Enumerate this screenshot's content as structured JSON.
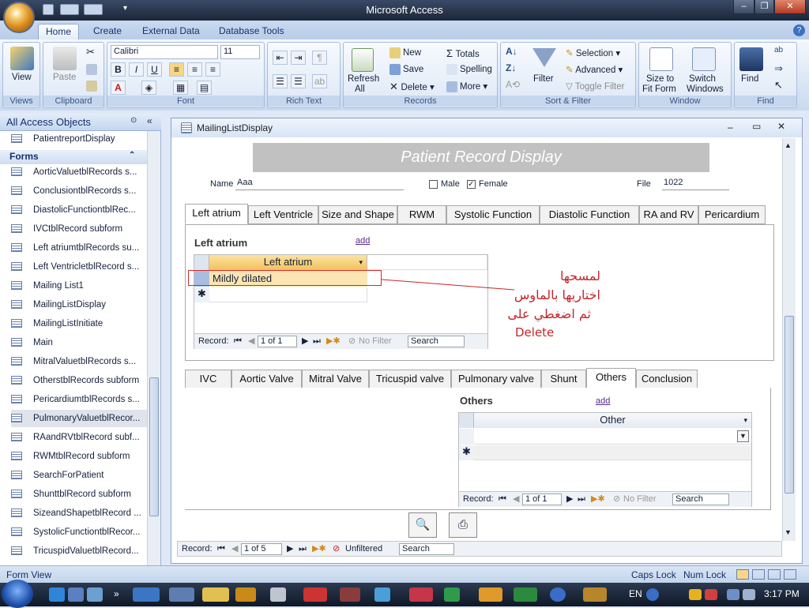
{
  "window": {
    "title": "Microsoft Access"
  },
  "ribbon": {
    "tabs": [
      "Home",
      "Create",
      "External Data",
      "Database Tools"
    ],
    "active_tab": "Home",
    "views": {
      "view": "View",
      "label": "Views"
    },
    "clipboard": {
      "paste": "Paste",
      "label": "Clipboard"
    },
    "font": {
      "family": "Calibri",
      "size": "11",
      "label": "Font"
    },
    "rich_text": {
      "label": "Rich Text"
    },
    "records": {
      "refresh": "Refresh",
      "refresh_all": "All",
      "new": "New",
      "save": "Save",
      "delete": "Delete",
      "totals": "Totals",
      "spelling": "Spelling",
      "more": "More",
      "label": "Records"
    },
    "sort_filter": {
      "filter": "Filter",
      "selection": "Selection",
      "advanced": "Advanced",
      "toggle_filter": "Toggle Filter",
      "label": "Sort & Filter"
    },
    "window": {
      "size_to_fit": "Size to",
      "size_to_fit2": "Fit Form",
      "switch": "Switch",
      "switch2": "Windows",
      "label": "Window"
    },
    "find": {
      "find": "Find",
      "label": "Find"
    }
  },
  "nav": {
    "header": "All Access Objects",
    "top_item": "PatientreportDisplay",
    "section": "Forms",
    "items": [
      "AorticValuetblRecords s...",
      "ConclusiontblRecords s...",
      "DiastolicFunctiontblRec...",
      "IVCtblRecord subform",
      "Left atriumtblRecords su...",
      "Left VentricletblRecord s...",
      "Mailing List1",
      "MailingListDisplay",
      "MailingListInitiate",
      "Main",
      "MitralValuetblRecords s...",
      "OtherstblRecords subform",
      "PericardiumtblRecords s...",
      "PulmonaryValuetblRecor...",
      "RAandRVtblRecord subf...",
      "RWMtblRecord subform",
      "SearchForPatient",
      "ShunttblRecord subform",
      "SizeandShapetblRecord ...",
      "SystolicFunctiontblRecor...",
      "TricuspidValuetblRecord..."
    ],
    "selected_index": 13
  },
  "form": {
    "window_title": "MailingListDisplay",
    "header": "Patient Record Display",
    "name_label": "Name",
    "name_value": "Aaa",
    "male_label": "Male",
    "female_label": "Female",
    "file_label": "File",
    "file_value": "1022",
    "tabs1": [
      "Left atrium",
      "Left Ventricle",
      "Size and Shape",
      "RWM",
      "Systolic Function",
      "Diastolic Function",
      "RA and RV",
      "Pericardium"
    ],
    "sub1": {
      "title": "Left atrium",
      "add": "add",
      "column": "Left atrium",
      "row": "Mildly dilated",
      "record_label": "Record:",
      "record_value": "1 of 1",
      "no_filter": "No Filter",
      "search": "Search"
    },
    "annotation": [
      "لمسحها",
      "اختاريها بالماوس",
      "ثم اضغطي على",
      "Delete"
    ],
    "tabs2": [
      "IVC",
      "Aortic Valve",
      "Mitral Valve",
      "Tricuspid valve",
      "Pulmonary valve",
      "Shunt",
      "Others",
      "Conclusion"
    ],
    "sub2": {
      "title": "Others",
      "add": "add",
      "column": "Other",
      "record_label": "Record:",
      "record_value": "1 of 1",
      "no_filter": "No Filter",
      "search": "Search"
    },
    "main_nav": {
      "record_label": "Record:",
      "record_value": "1 of 5",
      "filter": "Unfiltered",
      "search": "Search"
    }
  },
  "status": {
    "left": "Form View",
    "caps": "Caps Lock",
    "num": "Num Lock"
  },
  "taskbar": {
    "lang": "EN",
    "time": "3:17 PM"
  }
}
